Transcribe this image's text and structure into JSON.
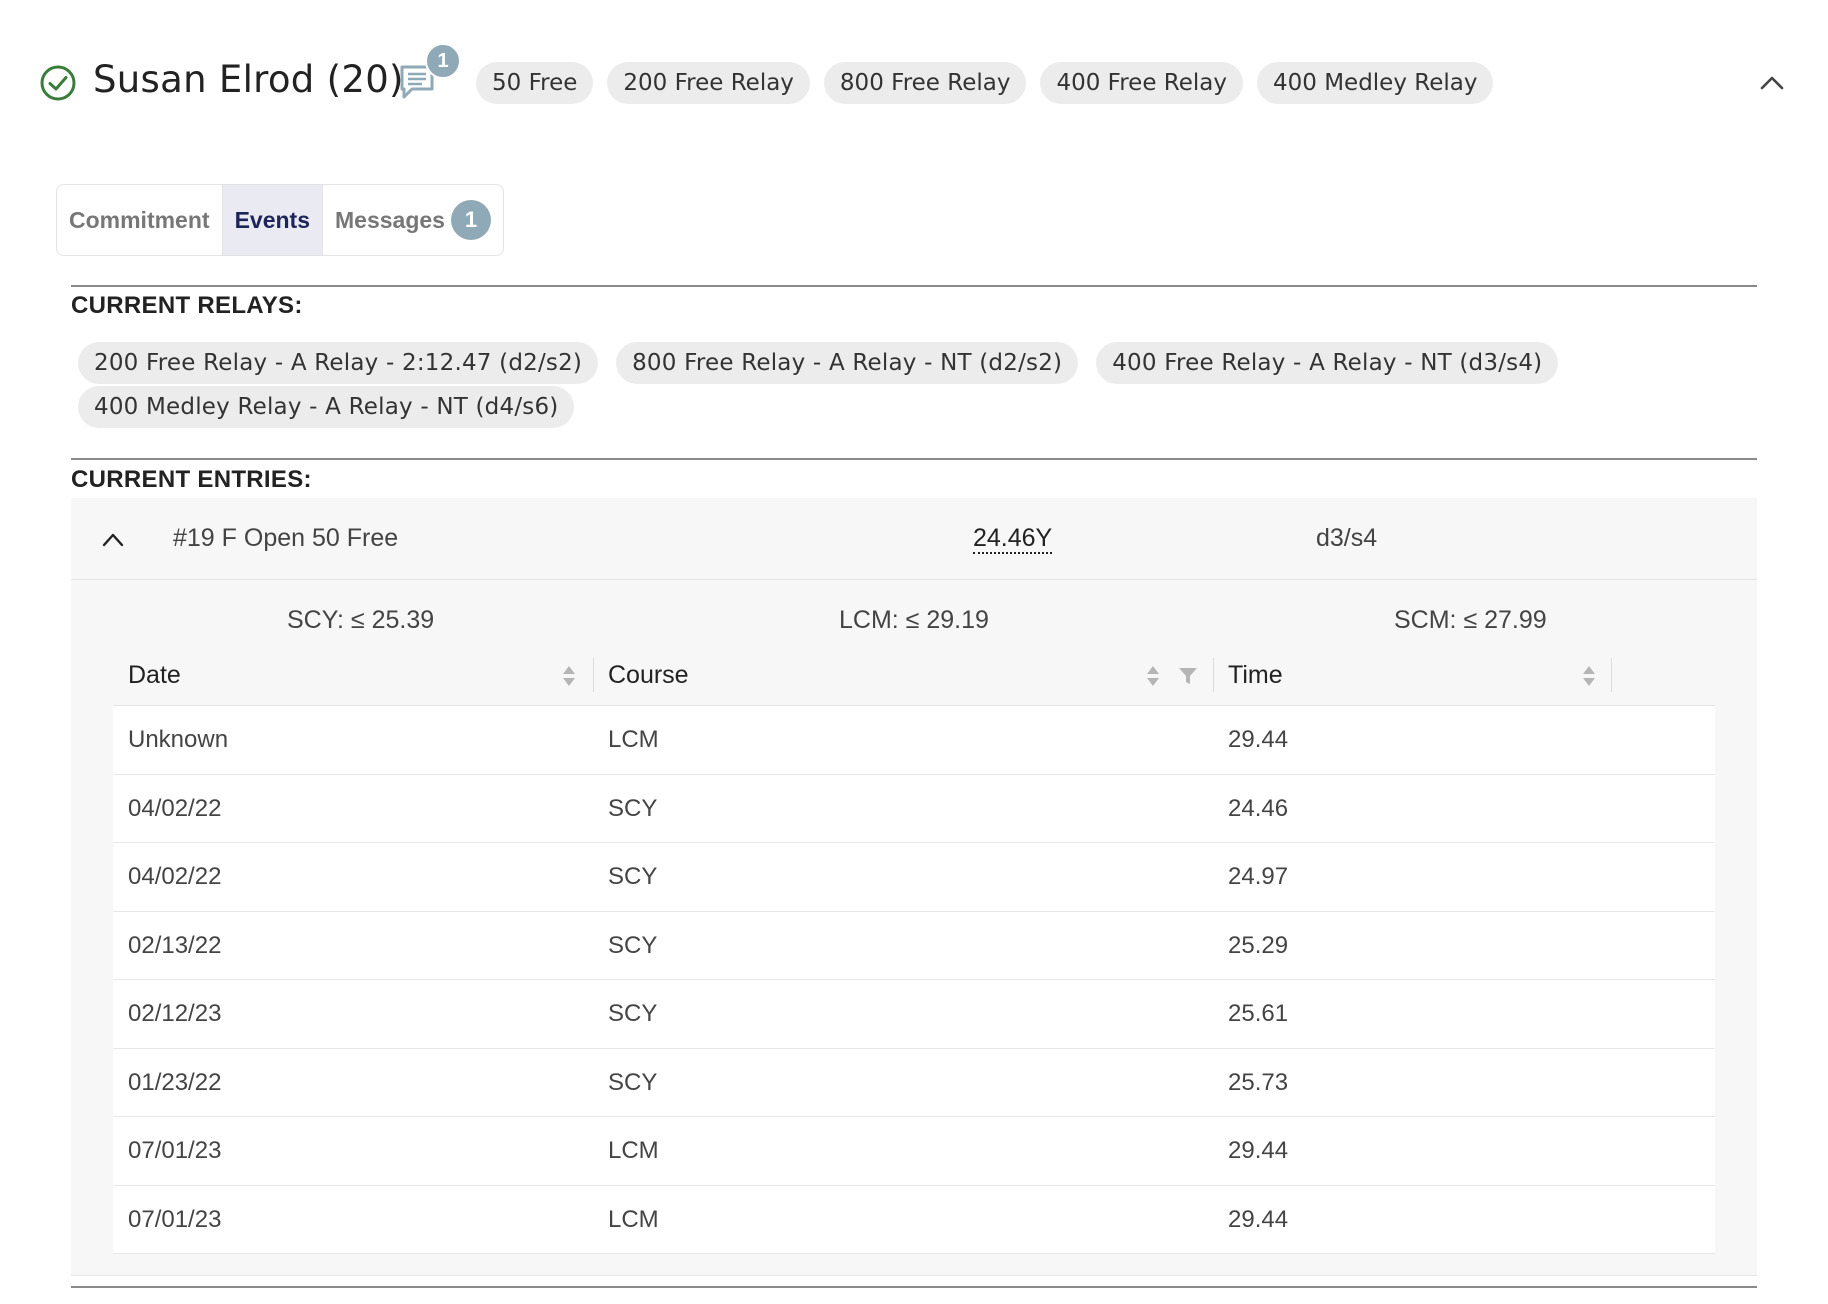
{
  "athlete": {
    "name": "Susan Elrod (20)",
    "status_icon": "check-circle-icon",
    "status_color": "#3a7d3a",
    "message_count": "1",
    "events": [
      "50 Free",
      "200 Free Relay",
      "800 Free Relay",
      "400 Free Relay",
      "400 Medley Relay"
    ]
  },
  "tabs": {
    "commitment": "Commitment",
    "events": "Events",
    "messages": "Messages",
    "messages_badge": "1",
    "active": "Events"
  },
  "relays": {
    "heading": "CURRENT RELAYS:",
    "items": [
      "200 Free Relay - A Relay - 2:12.47 (d2/s2)",
      "800 Free Relay - A Relay - NT (d2/s2)",
      "400 Free Relay - A Relay - NT (d3/s4)",
      "400 Medley Relay - A Relay - NT (d4/s6)"
    ]
  },
  "entries": {
    "heading": "CURRENT ENTRIES:",
    "entry": {
      "name": "#19 F Open 50 Free",
      "seed_time": "24.46Y",
      "heat_lane": "d3/s4",
      "standards": {
        "scy": "SCY: ≤ 25.39",
        "lcm": "LCM: ≤ 29.19",
        "scm": "SCM: ≤ 27.99"
      },
      "table": {
        "columns": [
          "Date",
          "Course",
          "Time"
        ],
        "rows": [
          [
            "Unknown",
            "LCM",
            "29.44"
          ],
          [
            "04/02/22",
            "SCY",
            "24.46"
          ],
          [
            "04/02/22",
            "SCY",
            "24.97"
          ],
          [
            "02/13/22",
            "SCY",
            "25.29"
          ],
          [
            "02/12/23",
            "SCY",
            "25.61"
          ],
          [
            "01/23/22",
            "SCY",
            "25.73"
          ],
          [
            "07/01/23",
            "LCM",
            "29.44"
          ],
          [
            "07/01/23",
            "LCM",
            "29.44"
          ]
        ]
      }
    }
  },
  "colors": {
    "badge": "#8fa9b7",
    "chip_bg": "#ececec",
    "active_tab_text": "#1d2559"
  }
}
